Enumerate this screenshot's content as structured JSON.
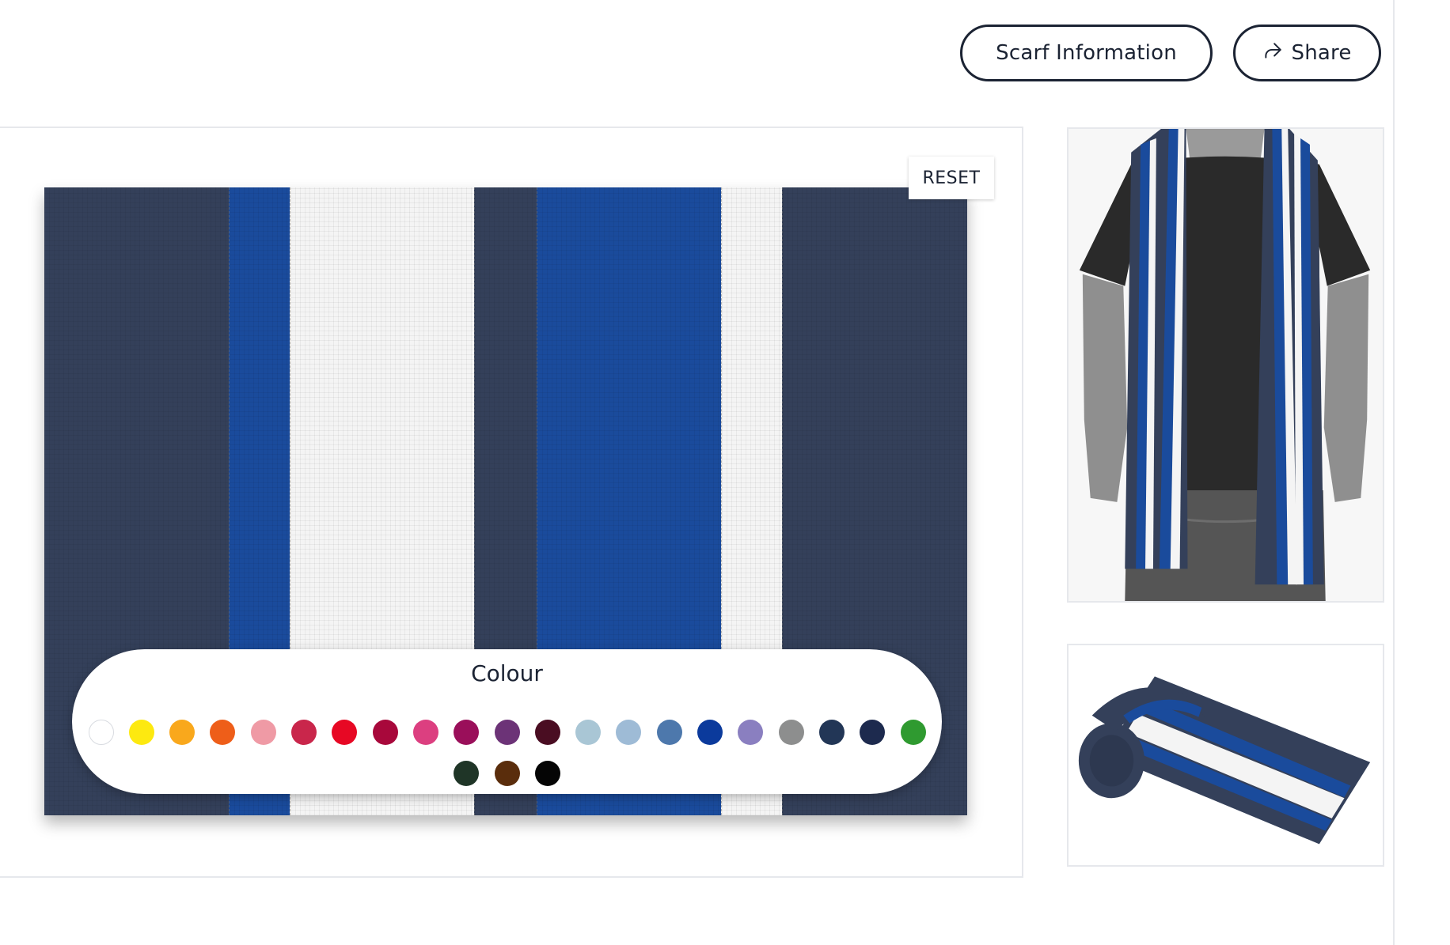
{
  "header": {
    "scarf_info_label": "Scarf Information",
    "share_label": "Share"
  },
  "designer": {
    "reset_label": "RESET",
    "stripes": [
      {
        "color": "#34405a",
        "weight": 234
      },
      {
        "color": "#1a4b9c",
        "weight": 77
      },
      {
        "color": "#f4f4f4",
        "weight": 233
      },
      {
        "color": "#34405a",
        "weight": 78
      },
      {
        "color": "#1a4b9c",
        "weight": 233
      },
      {
        "color": "#f4f4f4",
        "weight": 77
      },
      {
        "color": "#34405a",
        "weight": 234
      }
    ]
  },
  "colour_picker": {
    "title": "Colour",
    "swatches": [
      {
        "name": "white",
        "color": "#ffffff"
      },
      {
        "name": "yellow",
        "color": "#fde910"
      },
      {
        "name": "amber",
        "color": "#f9a81c"
      },
      {
        "name": "orange",
        "color": "#ee5e19"
      },
      {
        "name": "pink",
        "color": "#ef9aa5"
      },
      {
        "name": "crimson",
        "color": "#c9264b"
      },
      {
        "name": "red",
        "color": "#e70824"
      },
      {
        "name": "maroon",
        "color": "#a8083b"
      },
      {
        "name": "magenta",
        "color": "#dc3f80"
      },
      {
        "name": "plum",
        "color": "#9a0f5a"
      },
      {
        "name": "purple",
        "color": "#6c3377"
      },
      {
        "name": "burgundy",
        "color": "#4a0d22"
      },
      {
        "name": "powder-blue",
        "color": "#a9c6d5"
      },
      {
        "name": "light-blue",
        "color": "#9ebbd6"
      },
      {
        "name": "steel-blue",
        "color": "#4d78ac"
      },
      {
        "name": "royal-blue",
        "color": "#0b3a9c"
      },
      {
        "name": "lavender",
        "color": "#8a7fc0"
      },
      {
        "name": "grey",
        "color": "#8d8e8e"
      },
      {
        "name": "navy",
        "color": "#223656"
      },
      {
        "name": "dark-navy",
        "color": "#1d2a4e"
      },
      {
        "name": "green",
        "color": "#2f9a30"
      },
      {
        "name": "dark-green",
        "color": "#1f3527"
      },
      {
        "name": "brown",
        "color": "#5a2d0c"
      },
      {
        "name": "black",
        "color": "#050505"
      }
    ]
  }
}
